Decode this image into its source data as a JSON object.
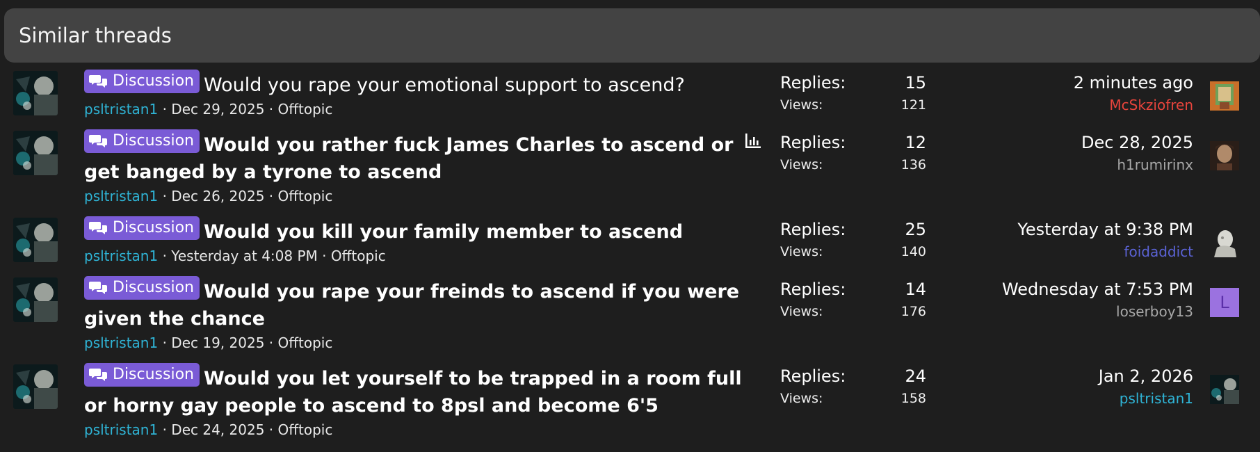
{
  "header": {
    "title": "Similar threads"
  },
  "prefix_label": "Discussion",
  "meta_separator": "·",
  "labels": {
    "replies": "Replies:",
    "views": "Views:"
  },
  "threads": [
    {
      "title": "Would you rape your emotional support to ascend?",
      "title_weight": "regular",
      "author": "psltristan1",
      "date": "Dec 29, 2025",
      "forum": "Offtopic",
      "replies": "15",
      "views": "121",
      "last_date": "2 minutes ago",
      "last_user": "McSkziofren",
      "last_user_color": "#e8443c",
      "has_poll": false
    },
    {
      "title": "Would you rather fuck James Charles to ascend or get banged by a tyrone to ascend",
      "title_weight": "bold",
      "author": "psltristan1",
      "date": "Dec 26, 2025",
      "forum": "Offtopic",
      "replies": "12",
      "views": "136",
      "last_date": "Dec 28, 2025",
      "last_user": "h1rumirinx",
      "last_user_color": "#a8a8a8",
      "has_poll": true,
      "poll_icon": "poll-chart-icon"
    },
    {
      "title": "Would you kill your family member to ascend",
      "title_weight": "bold",
      "author": "psltristan1",
      "date": "Yesterday at 4:08 PM",
      "forum": "Offtopic",
      "replies": "25",
      "views": "140",
      "last_date": "Yesterday at 9:38 PM",
      "last_user": "foidaddict",
      "last_user_color": "#5b63d6",
      "has_poll": false
    },
    {
      "title": "Would you rape your freinds to ascend if you were given the chance",
      "title_weight": "bold",
      "author": "psltristan1",
      "date": "Dec 19, 2025",
      "forum": "Offtopic",
      "replies": "14",
      "views": "176",
      "last_date": "Wednesday at 7:53 PM",
      "last_user": "loserboy13",
      "last_user_color": "#a8a8a8",
      "last_avatar_letter": "L",
      "has_poll": false
    },
    {
      "title": "Would you let yourself to be trapped in a room full or horny gay people to ascend to 8psl and become 6'5",
      "title_weight": "bold",
      "author": "psltristan1",
      "date": "Dec 24, 2025",
      "forum": "Offtopic",
      "replies": "24",
      "views": "158",
      "last_date": "Jan 2, 2026",
      "last_user": "psltristan1",
      "last_user_color": "#2fb4d6",
      "has_poll": false
    }
  ],
  "colors": {
    "prefix_bg": "#7a5bd6",
    "author": "#2fb4d6",
    "header_bg": "#434343",
    "page_bg": "#1e1e1e"
  }
}
